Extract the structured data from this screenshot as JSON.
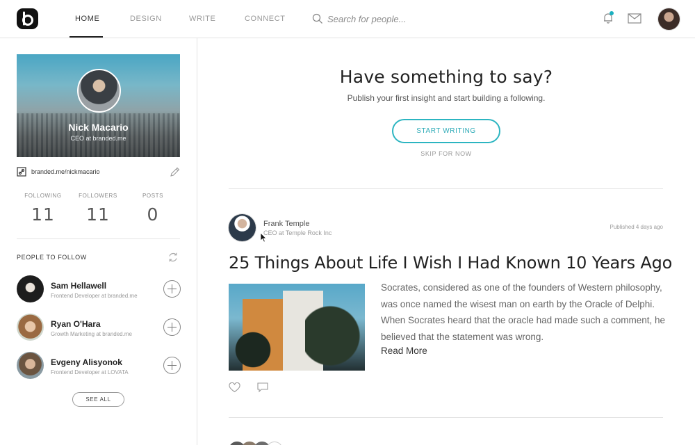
{
  "nav": {
    "logo_letter": "b",
    "items": [
      {
        "label": "HOME",
        "active": true
      },
      {
        "label": "DESIGN",
        "active": false
      },
      {
        "label": "WRITE",
        "active": false
      },
      {
        "label": "CONNECT",
        "active": false
      }
    ],
    "search_placeholder": "Search for people...",
    "icons": [
      "search-icon",
      "bell-icon",
      "mail-icon"
    ],
    "accent_color": "#1ab0c0"
  },
  "profile": {
    "name": "Nick Macario",
    "role": "CEO at branded.me",
    "link": "branded.me/nickmacario",
    "stats": [
      {
        "label": "FOLLOWING",
        "value": "11"
      },
      {
        "label": "FOLLOWERS",
        "value": "11"
      },
      {
        "label": "POSTS",
        "value": "0"
      }
    ]
  },
  "people_to_follow": {
    "heading": "PEOPLE TO FOLLOW",
    "people": [
      {
        "name": "Sam Hellawell",
        "role": "Frontend Developer at branded.me"
      },
      {
        "name": "Ryan O'Hara",
        "role": "Growth Marketing at branded.me"
      },
      {
        "name": "Evgeny Alisyonok",
        "role": "Frontend Developer at LOVATA"
      }
    ],
    "see_all_label": "SEE ALL"
  },
  "cta": {
    "title": "Have something to say?",
    "subtitle": "Publish your first insight and start building a following.",
    "button_label": "START WRITING",
    "skip_label": "SKIP FOR NOW",
    "accent_color": "#2cb5c1"
  },
  "post": {
    "author_name": "Frank Temple",
    "author_role": "CEO at Temple Rock Inc",
    "published": "Published 4 days ago",
    "title": "25 Things About Life I Wish I Had Known 10 Years Ago",
    "excerpt": "Socrates, considered as one of the founders of Western philosophy, was once named the wisest man on earth by the Oracle of Delphi. When Socrates heard that the oracle had made such a comment, he believed that the statement was wrong.",
    "read_more": "Read More"
  }
}
